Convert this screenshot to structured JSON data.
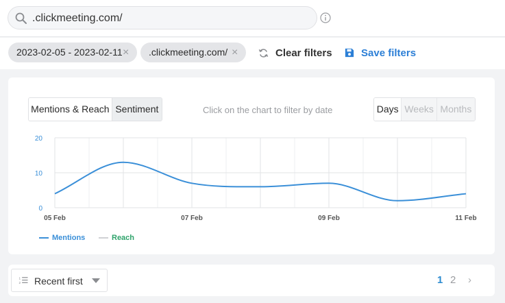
{
  "search": {
    "value": ".clickmeeting.com/"
  },
  "filters": {
    "chips": [
      ".clickmeeting.com/",
      "2023-02-05 - 2023-02-11"
    ],
    "clear_label": "Clear filters",
    "save_label": "Save filters"
  },
  "chart_panel": {
    "metric_tabs": [
      "Mentions & Reach",
      "Sentiment"
    ],
    "hint": "Click on the chart to filter by date",
    "period_tabs": [
      "Days",
      "Weeks",
      "Months"
    ],
    "selected_period": "Days",
    "legend": [
      "Mentions",
      "Reach"
    ]
  },
  "chart_data": {
    "type": "line",
    "x": [
      "05 Feb",
      "06 Feb",
      "07 Feb",
      "08 Feb",
      "09 Feb",
      "10 Feb",
      "11 Feb"
    ],
    "x_tick_labels": [
      "05 Feb",
      "07 Feb",
      "09 Feb",
      "11 Feb"
    ],
    "y_ticks": [
      "0",
      "10",
      "20"
    ],
    "ylim": [
      0,
      20
    ],
    "series": [
      {
        "name": "Mentions",
        "color": "#3a8fd8",
        "values": [
          4,
          13,
          7,
          6,
          7,
          2,
          4
        ]
      },
      {
        "name": "Reach",
        "color": "#cfd1d4",
        "values": []
      }
    ],
    "grid": true,
    "legend_position": "bottom-left"
  },
  "list_controls": {
    "sort_label": "Recent first",
    "pages": [
      "1",
      "2"
    ],
    "current_page": "1",
    "next_icon": "chevron-right-icon"
  },
  "colors": {
    "accent": "#2c7fd6",
    "line": "#3a8fd8",
    "reach": "#2fa36b"
  }
}
